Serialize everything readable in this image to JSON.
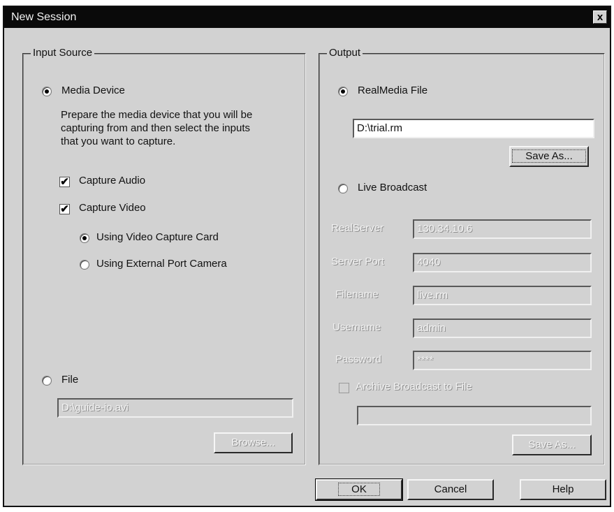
{
  "window": {
    "title": "New Session",
    "close_glyph": "x",
    "close_icon": "close-icon"
  },
  "input_source": {
    "legend": "Input Source",
    "media_device": {
      "label": "Media Device",
      "selected": true,
      "description": "Prepare the media device that you will be\ncapturing from and then select the inputs\nthat you want to capture.",
      "capture_audio": {
        "label": "Capture Audio",
        "checked": true
      },
      "capture_video": {
        "label": "Capture Video",
        "checked": true
      },
      "video_capture_card": {
        "label": "Using Video Capture Card",
        "selected": true
      },
      "external_port_camera": {
        "label": "Using External Port Camera",
        "selected": false
      }
    },
    "file": {
      "label": "File",
      "selected": false,
      "path_value": "D:\\guide-io.avi",
      "browse_label": "Browse..."
    }
  },
  "output": {
    "legend": "Output",
    "realmedia_file": {
      "label": "RealMedia File",
      "selected": true,
      "path_value": "D:\\trial.rm",
      "save_as_label": "Save As..."
    },
    "live_broadcast": {
      "label": "Live Broadcast",
      "selected": false,
      "realserver_label": "RealServer",
      "realserver_value": "130.34.10.6",
      "server_port_label": "Server Port",
      "server_port_value": "4040",
      "filename_label": "Filename",
      "filename_value": "live.rm",
      "username_label": "Username",
      "username_value": "admin",
      "password_label": "Password",
      "password_value": "****",
      "archive_label": "Archive Broadcast to File",
      "archive_checked": false,
      "archive_path_value": "",
      "archive_save_as_label": "Save As..."
    }
  },
  "buttons": {
    "ok": "OK",
    "cancel": "Cancel",
    "help": "Help"
  },
  "colors": {
    "dialog_bg": "#d2d2d2",
    "titlebar_bg": "#0a0a0a",
    "field_bg": "#ffffff"
  }
}
